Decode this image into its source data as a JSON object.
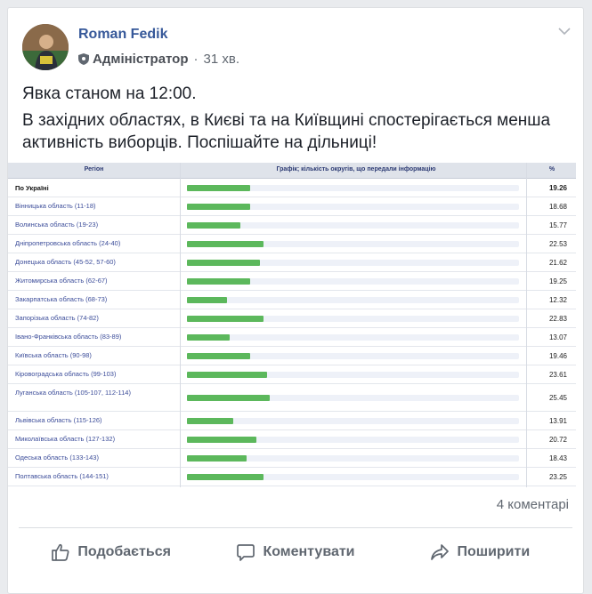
{
  "post": {
    "author": "Roman Fedik",
    "role": "Адміністратор",
    "time": "31 хв.",
    "line1": "Явка станом на 12:00.",
    "text": "В західних областях, в Києві та на Київщині спостерігається менша активність виборців. Поспішайте на дільниці!"
  },
  "table": {
    "col_region": "Регіон",
    "col_graph": "Графік; кількість округів, що передали інформацію",
    "col_pct": "%",
    "bar_color": "#5cb85c",
    "rows": [
      {
        "region": "По Україні",
        "value": "19.26",
        "fill": 0.19
      },
      {
        "region": "Вінницька область (11-18)",
        "value": "18.68",
        "fill": 0.19
      },
      {
        "region": "Волинська область (19-23)",
        "value": "15.77",
        "fill": 0.16
      },
      {
        "region": "Дніпропетровська область (24-40)",
        "value": "22.53",
        "fill": 0.23
      },
      {
        "region": "Донецька область (45-52, 57-60)",
        "value": "21.62",
        "fill": 0.22
      },
      {
        "region": "Житомирська область (62-67)",
        "value": "19.25",
        "fill": 0.19
      },
      {
        "region": "Закарпатська область (68-73)",
        "value": "12.32",
        "fill": 0.12
      },
      {
        "region": "Запорізька область (74-82)",
        "value": "22.83",
        "fill": 0.23
      },
      {
        "region": "Івано-Франківська область (83-89)",
        "value": "13.07",
        "fill": 0.13
      },
      {
        "region": "Київська область (90-98)",
        "value": "19.46",
        "fill": 0.19
      },
      {
        "region": "Кіровоградська область (99-103)",
        "value": "23.61",
        "fill": 0.24
      },
      {
        "region": "Луганська область (105-107, 112-114)",
        "value": "25.45",
        "fill": 0.25
      },
      {
        "region": "Львівська область (115-126)",
        "value": "13.91",
        "fill": 0.14
      },
      {
        "region": "Миколаївська область (127-132)",
        "value": "20.72",
        "fill": 0.21
      },
      {
        "region": "Одеська область (133-143)",
        "value": "18.43",
        "fill": 0.18
      },
      {
        "region": "Полтавська область (144-151)",
        "value": "23.25",
        "fill": 0.23
      }
    ]
  },
  "footer": {
    "comments": "4 коментарі",
    "like": "Подобається",
    "comment": "Коментувати",
    "share": "Поширити"
  },
  "icons": {
    "like": "thumbs-up-icon",
    "comment": "speech-bubble-icon",
    "share": "share-arrow-icon",
    "role": "shield-icon",
    "menu": "chevron-down-icon"
  }
}
